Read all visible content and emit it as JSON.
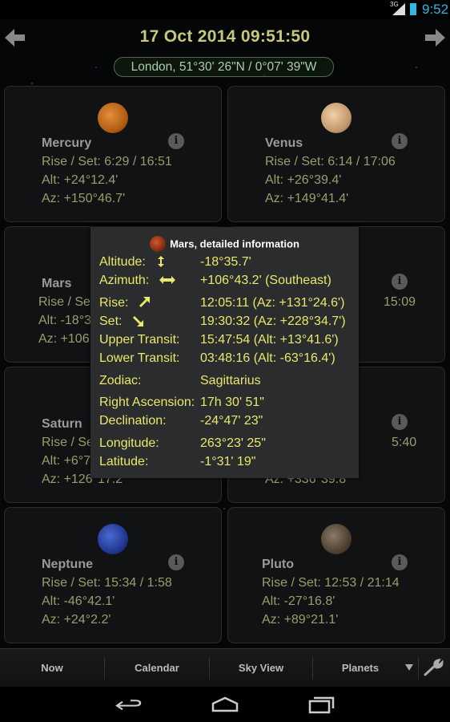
{
  "status_bar": {
    "network": "3G",
    "time": "9:52"
  },
  "header": {
    "datetime": "17 Oct 2014  09:51:50",
    "location": "London,  51°30' 26\"N  /  0°07' 39\"W"
  },
  "planets": [
    {
      "name": "Mercury",
      "rise_set": "Rise / Set: 6:29  /  16:51",
      "alt": "Alt: +24°12.4'",
      "az": "Az: +150°46.7'",
      "color": "#c7721f"
    },
    {
      "name": "Venus",
      "rise_set": "Rise / Set: 6:14  /  17:06",
      "alt": "Alt: +26°39.4'",
      "az": "Az: +149°41.4'",
      "color": "#c9a27a"
    },
    {
      "name": "Mars",
      "rise_set": "Rise / Se",
      "rise_set_end": "15:09",
      "alt": "Alt: -18°3",
      "az": "Az: +106",
      "color": "#b24a22"
    },
    {
      "name": "Saturn",
      "rise_set": "Rise / Se",
      "rise_set_end": "5:40",
      "alt": "Alt: +6°7",
      "az": "Az: +126°17.2'",
      "az_right": "Az: +336°39.8'",
      "color": "#b9a37a"
    },
    {
      "name": "Neptune",
      "rise_set": "Rise / Set: 15:34  /  1:58",
      "alt": "Alt: -46°42.1'",
      "az": "Az: +24°2.2'",
      "color": "#2a3f9a"
    },
    {
      "name": "Pluto",
      "rise_set": "Rise / Set: 12:53  /  21:14",
      "alt": "Alt: -27°16.8'",
      "az": "Az: +89°21.1'",
      "color": "#6a5a48"
    }
  ],
  "popup": {
    "title": "Mars, detailed information",
    "rows": [
      {
        "label": "Altitude:",
        "value": "-18°35.7'",
        "icon": "up-down-arrow-icon"
      },
      {
        "label": "Azimuth:",
        "value": "+106°43.2' (Southeast)",
        "icon": "left-right-arrow-icon"
      },
      {
        "label": "Rise:",
        "value": "12:05:11 (Az: +131°24.6')",
        "icon": "rise-arrow-icon"
      },
      {
        "label": "Set:",
        "value": "19:30:32 (Az: +228°34.7')",
        "icon": "set-arrow-icon"
      },
      {
        "label": "Upper Transit:",
        "value": "15:47:54 (Alt: +13°41.6')"
      },
      {
        "label": "Lower Transit:",
        "value": "03:48:16 (Alt: -63°16.4')"
      },
      {
        "label": "Zodiac:",
        "value": "Sagittarius"
      },
      {
        "label": "Right Ascension:",
        "value": "17h 30' 51\""
      },
      {
        "label": "Declination:",
        "value": "-24°47' 23\""
      },
      {
        "label": "Longitude:",
        "value": "263°23' 25\""
      },
      {
        "label": "Latitude:",
        "value": "-1°31' 19\""
      }
    ]
  },
  "tabs": [
    "Now",
    "Calendar",
    "Sky View",
    "Planets"
  ],
  "colors": {
    "header_text": "#c8c87a",
    "card_text": "#93a06b",
    "popup_text": "#e8e86a",
    "status_blue": "#33b5e5"
  }
}
